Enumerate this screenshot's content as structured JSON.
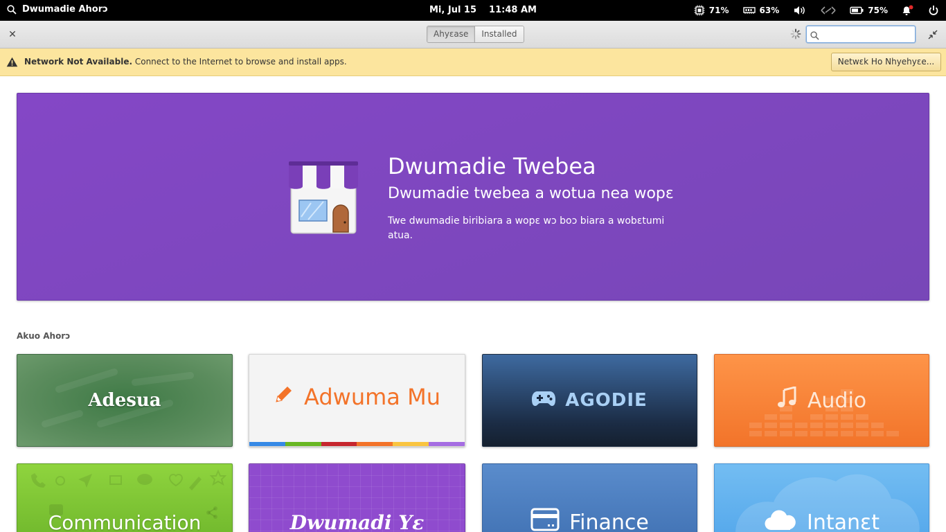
{
  "panel": {
    "app_title": "Dwumadie Ahorɔ",
    "date": "Mi, Jul 15",
    "time": "11:48 AM",
    "cpu": "71%",
    "memory": "63%",
    "battery": "75%"
  },
  "header": {
    "tabs": [
      {
        "label": "Ahyɛase",
        "active": true
      },
      {
        "label": "Installed",
        "active": false
      }
    ],
    "search": {
      "value": "",
      "placeholder": ""
    }
  },
  "infobar": {
    "title": "Network Not Available.",
    "message": "Connect to the Internet to browse and install apps.",
    "button": "Netwɛk Ho Nhyehyɛe..."
  },
  "banner": {
    "title": "Dwumadie Twebea",
    "subtitle": "Dwumadie twebea a wotua nea wopɛ",
    "description": "Twe dwumadie biribiara a wopɛ wɔ boɔ biara a wobɛtumi atua.",
    "color": "#7e47bf"
  },
  "categories": {
    "title": "Akuo Ahorɔ",
    "items": [
      {
        "label": "Adesua",
        "color": "#5b8c5d"
      },
      {
        "label": "Adwuma Mu",
        "color": "#f37329",
        "icon": "pencil-icon"
      },
      {
        "label": "AGODIE",
        "color": "#1b2c45",
        "icon": "gamepad-icon"
      },
      {
        "label": "Audio",
        "color": "#f58538",
        "icon": "music-note-icon"
      },
      {
        "label": "Communication",
        "color": "#7cc432"
      },
      {
        "label": "Dwumadi Yɛ",
        "color": "#8f4bce"
      },
      {
        "label": "Finance",
        "color": "#4a7cbf",
        "icon": "credit-card-icon"
      },
      {
        "label": "Intanɛt",
        "color": "#62b0ee",
        "icon": "cloud-icon"
      }
    ]
  },
  "stripe_colors": [
    "#3689e6",
    "#68b723",
    "#c6262e",
    "#f37329",
    "#f9c440",
    "#a56de2"
  ]
}
